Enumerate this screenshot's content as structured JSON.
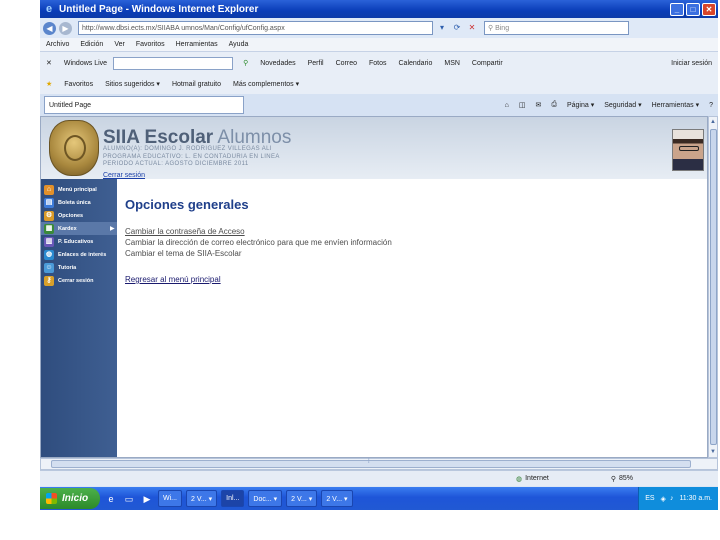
{
  "window": {
    "title": "Untitled Page - Windows Internet Explorer"
  },
  "address": {
    "url": "http://www.dbsi.ects.mx/SIIABA umnos/Man/Config/ufConfig.aspx",
    "search_placeholder": "Bing"
  },
  "menu": [
    "Archivo",
    "Edición",
    "Ver",
    "Favoritos",
    "Herramientas",
    "Ayuda"
  ],
  "live_toolbar": {
    "brand": "Windows Live",
    "items": [
      "Novedades",
      "Perfil",
      "Correo",
      "Fotos",
      "Calendario",
      "MSN",
      "Compartir"
    ],
    "signin": "Iniciar sesión"
  },
  "favorites": {
    "label": "Favoritos",
    "items": [
      "Sitios sugeridos ▾",
      "Hotmail gratuito",
      "Más complementos ▾"
    ]
  },
  "tab": {
    "title": "Untitled Page"
  },
  "commands": [
    "Página ▾",
    "Seguridad ▾",
    "Herramientas ▾"
  ],
  "header": {
    "brand_bold": "SIIA Escolar",
    "brand_light": "Alumnos",
    "info_lines": [
      "ALUMNO(A): DOMINGO J. RODRIGUEZ VILLEGAS ALI",
      "PROGRAMA EDUCATIVO: L. EN CONTADURIA EN LINEA",
      "PERIODO ACTUAL: AGOSTO DICIEMBRE 2011"
    ],
    "logout": "Cerrar sesión"
  },
  "sidebar": {
    "items": [
      {
        "label": "Menú principal",
        "icon": "home-icon"
      },
      {
        "label": "Boleta única",
        "icon": "document-icon"
      },
      {
        "label": "Opciones",
        "icon": "gear-icon"
      },
      {
        "label": "Kardex",
        "icon": "table-icon"
      },
      {
        "label": "P. Educativos",
        "icon": "book-icon"
      },
      {
        "label": "Enlaces de interés",
        "icon": "globe-icon"
      },
      {
        "label": "Tutoría",
        "icon": "people-icon"
      },
      {
        "label": "Cerrar sesión",
        "icon": "key-icon"
      }
    ]
  },
  "content": {
    "heading": "Opciones generales",
    "options": [
      "Cambiar la contraseña de Acceso",
      "Cambiar la dirección de correo electrónico para que me envíen información",
      "Cambiar el tema de SIIA-Escolar"
    ],
    "back": "Regresar al menú principal"
  },
  "status": {
    "zone": "Internet",
    "zoom": "85%"
  },
  "taskbar": {
    "start": "Inicio",
    "tasks": [
      "Wi...",
      "2 V... ▾",
      "Inl...",
      "Doc... ▾",
      "2 V... ▾",
      "2 V... ▾"
    ],
    "lang": "ES",
    "clock": "11:30 a.m."
  }
}
